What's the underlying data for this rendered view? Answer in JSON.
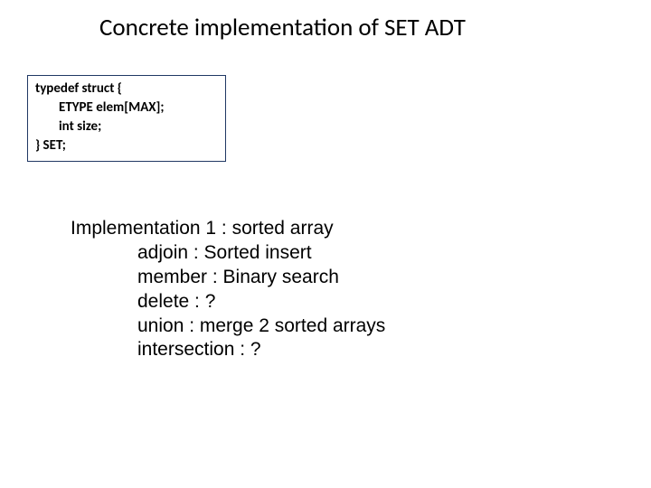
{
  "title": "Concrete implementation of SET ADT",
  "code": {
    "l1": "typedef struct {",
    "l2": "ETYPE elem[MAX];",
    "l3": "int size;",
    "l4": "} SET;"
  },
  "body": {
    "head": "Implementation 1 : sorted array",
    "i1": "adjoin : Sorted insert",
    "i2": "member : Binary search",
    "i3": "delete : ?",
    "i4": "union : merge 2 sorted arrays",
    "i5": "intersection : ?"
  }
}
